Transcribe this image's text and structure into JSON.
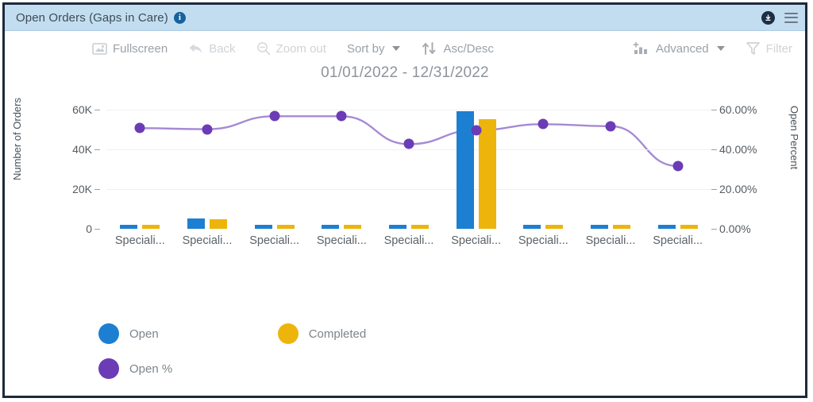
{
  "header": {
    "title": "Open Orders (Gaps in Care)",
    "info_icon": "info-icon",
    "download_icon": "download-icon",
    "menu_icon": "hamburger-menu-icon"
  },
  "toolbar": {
    "fullscreen": "Fullscreen",
    "back": "Back",
    "zoom_out": "Zoom out",
    "sort_by": "Sort by",
    "asc_desc": "Asc/Desc",
    "advanced": "Advanced",
    "filter": "Filter"
  },
  "subtitle": "01/01/2022 - 12/31/2022",
  "legend": {
    "open": "Open",
    "completed": "Completed",
    "open_pct": "Open %"
  },
  "colors": {
    "open": "#1d7fd1",
    "completed": "#edb50c",
    "open_pct": "#6b3cb6",
    "header_bg": "#c3ddf0",
    "frame": "#1d2a3a"
  },
  "chart_data": {
    "type": "bar",
    "title": "Open Orders (Gaps in Care)",
    "subtitle": "01/01/2022 - 12/31/2022",
    "xlabel": "",
    "ylabel": "Number of Orders",
    "y2label": "Open Percent",
    "categories": [
      "Speciali...",
      "Speciali...",
      "Speciali...",
      "Speciali...",
      "Speciali...",
      "Speciali...",
      "Speciali...",
      "Speciali...",
      "Speciali..."
    ],
    "ylim": [
      0,
      65000
    ],
    "yticks": [
      0,
      20000,
      40000,
      60000
    ],
    "ytick_labels": [
      "0",
      "20K",
      "40K",
      "60K"
    ],
    "y2lim": [
      0,
      65
    ],
    "y2ticks": [
      0,
      20,
      40,
      60
    ],
    "y2tick_labels": [
      "0.00%",
      "20.00%",
      "40.00%",
      "60.00%"
    ],
    "grid": true,
    "legend_position": "bottom-left",
    "series": [
      {
        "name": "Open",
        "type": "bar",
        "axis": "left",
        "color": "#1d7fd1",
        "values": [
          600,
          5200,
          600,
          600,
          600,
          59000,
          600,
          600,
          600
        ]
      },
      {
        "name": "Completed",
        "type": "bar",
        "axis": "left",
        "color": "#edb50c",
        "values": [
          500,
          4800,
          500,
          500,
          500,
          55000,
          500,
          500,
          500
        ]
      },
      {
        "name": "Open %",
        "type": "line",
        "axis": "right",
        "color": "#6b3cb6",
        "values": [
          50.5,
          50.0,
          56.5,
          56.5,
          42.5,
          49.5,
          52.5,
          51.5,
          31.5
        ]
      }
    ]
  }
}
